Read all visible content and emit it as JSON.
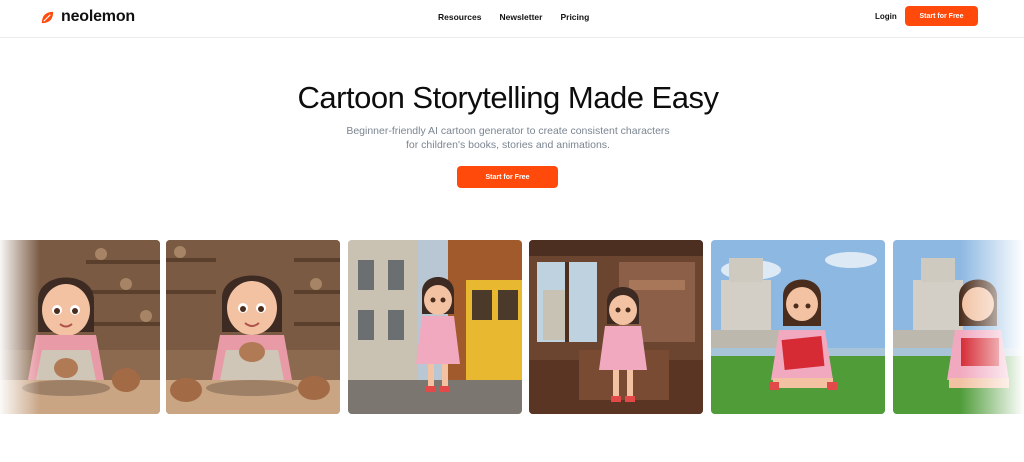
{
  "brand": {
    "name": "neolemon",
    "logo_icon": "leaf-logo-icon",
    "accent_color": "#ff4a0c"
  },
  "nav": {
    "items": [
      {
        "label": "Resources"
      },
      {
        "label": "Newsletter"
      },
      {
        "label": "Pricing"
      }
    ],
    "login_label": "Login",
    "cta_label": "Start for Free"
  },
  "hero": {
    "title": "Cartoon Storytelling Made Easy",
    "subtitle_line1": "Beginner-friendly AI cartoon generator to create consistent characters",
    "subtitle_line2": "for children's books, stories and animations.",
    "cta_label": "Start for Free"
  },
  "gallery": {
    "images": [
      {
        "scene": "girl making pottery in workshop"
      },
      {
        "scene": "girl making pottery in workshop"
      },
      {
        "scene": "girl standing next to yellow tram on street"
      },
      {
        "scene": "girl sitting inside tram by window"
      },
      {
        "scene": "girl reading red book on grass near tower"
      },
      {
        "scene": "girl reading red book on grass near tower"
      }
    ]
  }
}
